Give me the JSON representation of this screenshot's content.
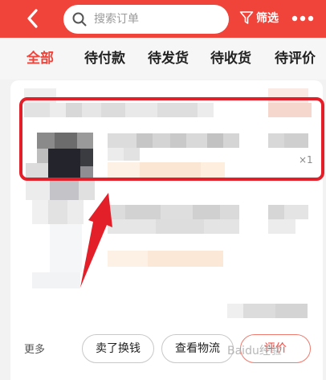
{
  "header": {
    "search_placeholder": "搜索订单",
    "filter_label": "筛选",
    "brand_color": "#f0433a"
  },
  "tabs": [
    {
      "label": "全部",
      "active": true
    },
    {
      "label": "待付款",
      "active": false
    },
    {
      "label": "待发货",
      "active": false
    },
    {
      "label": "待收货",
      "active": false
    },
    {
      "label": "待评价",
      "active": false
    }
  ],
  "order": {
    "quantity": "×1"
  },
  "actions": {
    "more_label": "更多",
    "sell_label": "卖了换钱",
    "logistics_label": "查看物流",
    "rate_label": "评价"
  },
  "watermark": "Baidu经验",
  "icons": [
    "back-arrow-icon",
    "search-icon",
    "filter-icon",
    "more-dots-icon"
  ]
}
